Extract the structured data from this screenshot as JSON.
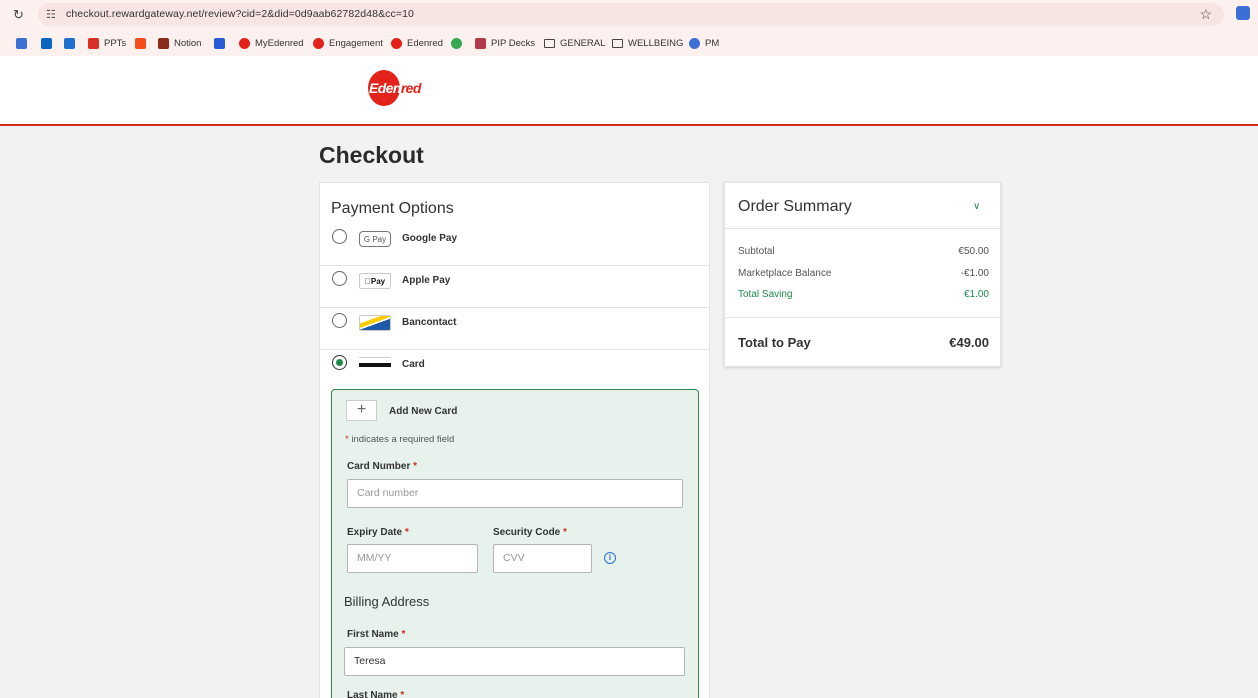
{
  "browser": {
    "url": "checkout.rewardgateway.net/review?cid=2&did=0d9aab62782d48&cc=10",
    "bookmarks": [
      {
        "label": "PPTs",
        "color": "#d93025"
      },
      {
        "label": "Notion",
        "color": "#8b2b1b"
      },
      {
        "label": "MyEdenred",
        "color": "#e3231b"
      },
      {
        "label": "Engagement",
        "color": "#e3231b"
      },
      {
        "label": "Edenred",
        "color": "#e3231b"
      },
      {
        "label": "PIP Decks",
        "color": "#b23a48"
      },
      {
        "label": "GENERAL",
        "color": "folder"
      },
      {
        "label": "WELLBEING",
        "color": "folder"
      },
      {
        "label": "PM",
        "color": "#3b6fd6"
      }
    ]
  },
  "brand": {
    "logo_text_a": "Eden",
    "logo_text_b": "red",
    "accent": "#e3231b"
  },
  "page": {
    "title": "Checkout"
  },
  "payment": {
    "heading": "Payment Options",
    "options": [
      {
        "label": "Google Pay",
        "logo": "G Pay",
        "selected": false
      },
      {
        "label": "Apple Pay",
        "logo": "Pay",
        "selected": false
      },
      {
        "label": "Bancontact",
        "logo": "",
        "selected": false
      },
      {
        "label": "Card",
        "logo": "",
        "selected": true
      }
    ],
    "card_form": {
      "add_new_card": "Add New Card",
      "required_note": "indicates a required field",
      "card_number_label": "Card Number",
      "card_number_placeholder": "Card number",
      "expiry_label": "Expiry Date",
      "expiry_placeholder": "MM/YY",
      "security_label": "Security Code",
      "security_placeholder": "CVV",
      "billing_heading": "Billing Address",
      "first_name_label": "First Name",
      "first_name_value": "Teresa",
      "last_name_label": "Last Name"
    }
  },
  "summary": {
    "title": "Order Summary",
    "rows": [
      {
        "label": "Subtotal",
        "value": "€50.00"
      },
      {
        "label": "Marketplace Balance",
        "value": "-€1.00"
      },
      {
        "label": "Total Saving",
        "value": "€1.00"
      }
    ],
    "total_label": "Total to Pay",
    "total_value": "€49.00"
  }
}
